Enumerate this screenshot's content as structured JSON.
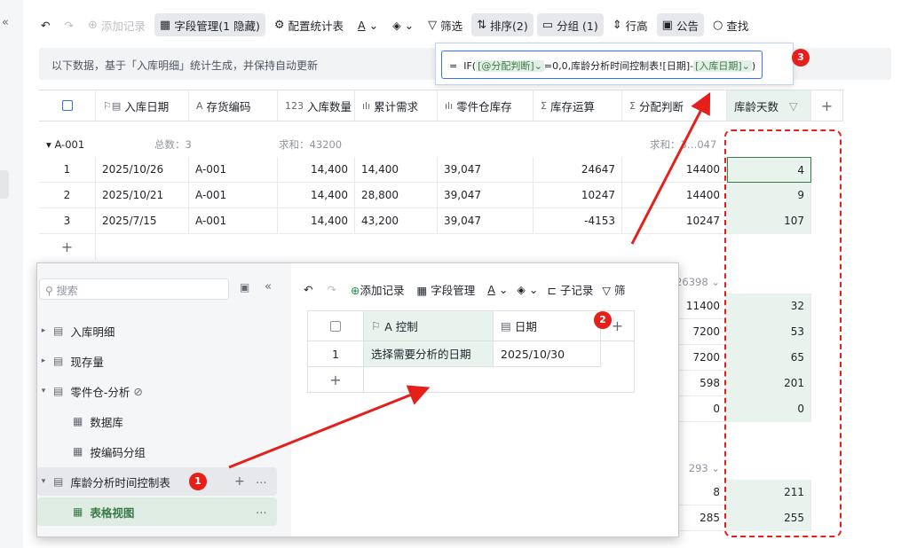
{
  "toolbar": {
    "undo_icon": "undo-icon",
    "redo_icon": "redo-icon",
    "add_record": "添加记录",
    "field_manage": "字段管理(1 隐藏)",
    "config_stats": "配置统计表",
    "text_color_icon": "text-color-icon",
    "fill_icon": "fill-color-icon",
    "filter": "筛选",
    "sort": "排序(2)",
    "group": "分组 (1)",
    "row_height": "行高",
    "announcement": "公告",
    "find": "查找"
  },
  "notice": "以下数据，基于「入库明细」统计生成，并保持自动更新",
  "formula": {
    "prefix": "=",
    "func": "IF(",
    "field": "[@分配判断]",
    "rest": "=0,0,库龄分析时间控制表![日期]-",
    "field2": "[入库日期]",
    "close": ")"
  },
  "badges": {
    "one": "1",
    "two": "2",
    "three": "3"
  },
  "columns": [
    "入库日期",
    "存货编码",
    "入库数量",
    "累计需求",
    "零件仓库存",
    "库存运算",
    "分配判断",
    "库龄天数"
  ],
  "group_a": {
    "name": "A-001",
    "count_label": "总数：3",
    "sum_label": "求和：43200",
    "sum_right": "求和：3…047"
  },
  "rows": [
    {
      "idx": "1",
      "date": "2025/10/26",
      "code": "A-001",
      "qty": "14,400",
      "cum": "14,400",
      "stock": "39,047",
      "calc": "24647",
      "alloc": "14400",
      "age": "4"
    },
    {
      "idx": "2",
      "date": "2025/10/21",
      "code": "A-001",
      "qty": "14,400",
      "cum": "28,800",
      "stock": "39,047",
      "calc": "10247",
      "alloc": "14400",
      "age": "9"
    },
    {
      "idx": "3",
      "date": "2025/7/15",
      "code": "A-001",
      "qty": "14,400",
      "cum": "43,200",
      "stock": "39,047",
      "calc": "-4153",
      "alloc": "10247",
      "age": "107"
    }
  ],
  "group_b": {
    "sum_right": "26398",
    "rows": [
      {
        "alloc": "11400",
        "age": "32"
      },
      {
        "alloc": "7200",
        "age": "53"
      },
      {
        "alloc": "7200",
        "age": "65"
      },
      {
        "alloc": "598",
        "age": "201"
      },
      {
        "alloc": "0",
        "age": "0"
      }
    ]
  },
  "group_c": {
    "sum_right": "293",
    "rows": [
      {
        "alloc": "8",
        "age": "211"
      },
      {
        "alloc": "285",
        "age": "255"
      }
    ]
  },
  "add_row": "+",
  "popup": {
    "search_placeholder": "搜索",
    "tree": [
      {
        "label": "入库明细"
      },
      {
        "label": "现存量"
      },
      {
        "label": "零件仓-分析"
      },
      {
        "label": "数据库"
      },
      {
        "label": "按编码分组"
      },
      {
        "label": "库龄分析时间控制表"
      },
      {
        "label": "表格视图"
      }
    ],
    "toolbar": {
      "add_record": "添加记录",
      "field_manage": "字段管理",
      "sub_record": "子记录",
      "filter": "筛"
    },
    "columns": [
      "A 控制",
      "日期"
    ],
    "row": {
      "idx": "1",
      "control": "选择需要分析的日期",
      "date": "2025/10/30"
    }
  }
}
